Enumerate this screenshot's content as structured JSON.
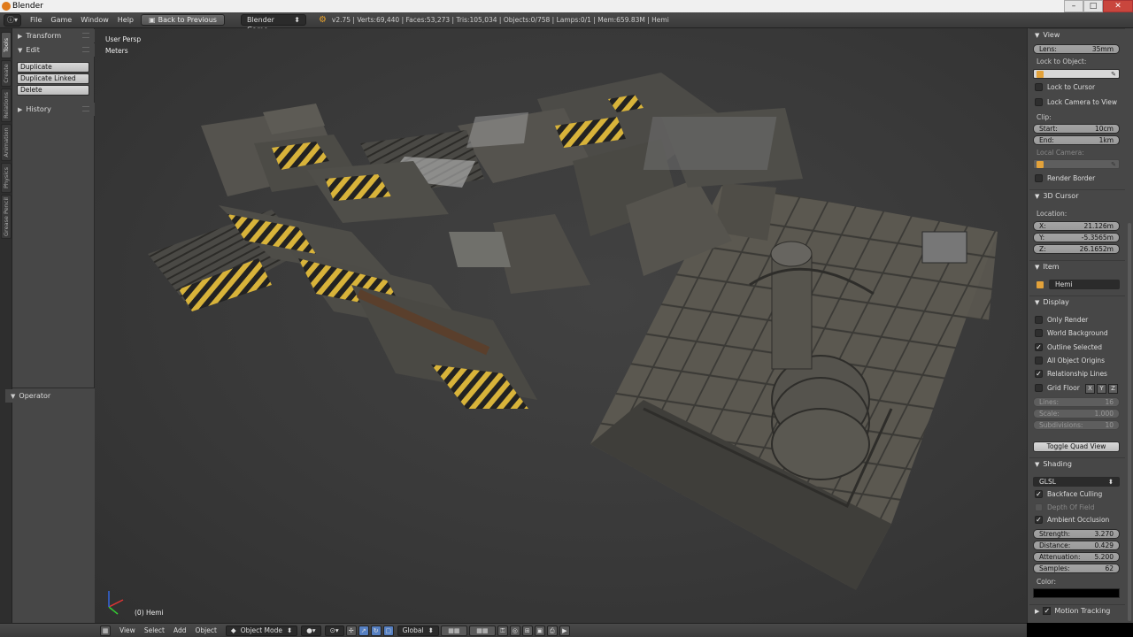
{
  "window": {
    "title": "Blender",
    "minimize": "–",
    "maximize": "□",
    "close": "✕"
  },
  "info_header": {
    "editor_icon": "i-icon",
    "menus": [
      "File",
      "Game",
      "Window",
      "Help"
    ],
    "back_button": "Back to Previous",
    "engine": "Blender Game",
    "stats": "v2.75 | Verts:69,440 | Faces:53,273 | Tris:105,034 | Objects:0/758 | Lamps:0/1 | Mem:659.83M | Hemi"
  },
  "tab_strip": [
    "Tools",
    "Create",
    "Relations",
    "Animation",
    "Physics",
    "Grease Pencil"
  ],
  "tool_shelf": {
    "transform_label": "Transform",
    "edit_label": "Edit",
    "buttons": [
      "Duplicate",
      "Duplicate Linked",
      "Delete"
    ],
    "history_label": "History",
    "operator_label": "Operator"
  },
  "viewport": {
    "view_name": "User Persp",
    "units": "Meters",
    "object_label": "(0) Hemi",
    "accent_yellow": "#d8b33a",
    "floor_color": "#5b5850"
  },
  "bottom_header": {
    "menus": [
      "View",
      "Select",
      "Add",
      "Object"
    ],
    "mode": "Object Mode",
    "orientation": "Global"
  },
  "properties": {
    "view": {
      "header": "View",
      "lens_label": "Lens:",
      "lens_value": "35mm",
      "lock_to_object": "Lock to Object:",
      "lock_to_cursor": "Lock to Cursor",
      "lock_camera": "Lock Camera to View",
      "clip_label": "Clip:",
      "start_label": "Start:",
      "start_value": "10cm",
      "end_label": "End:",
      "end_value": "1km",
      "local_camera": "Local Camera:",
      "render_border": "Render Border"
    },
    "cursor": {
      "header": "3D Cursor",
      "location_label": "Location:",
      "x_label": "X:",
      "x_value": "21.126m",
      "y_label": "Y:",
      "y_value": "-5.3565m",
      "z_label": "Z:",
      "z_value": "26.1652m"
    },
    "item": {
      "header": "Item",
      "name": "Hemi"
    },
    "display": {
      "header": "Display",
      "only_render": "Only Render",
      "world_background": "World Background",
      "outline_selected": "Outline Selected",
      "all_object_origins": "All Object Origins",
      "relationship_lines": "Relationship Lines",
      "grid_floor": "Grid Floor",
      "axis_x": "X",
      "axis_y": "Y",
      "axis_z": "Z",
      "lines_label": "Lines:",
      "lines_value": "16",
      "scale_label": "Scale:",
      "scale_value": "1.000",
      "subdivisions_label": "Subdivisions:",
      "subdivisions_value": "10",
      "toggle_quad_view": "Toggle Quad View"
    },
    "shading": {
      "header": "Shading",
      "mode": "GLSL",
      "backface_culling": "Backface Culling",
      "depth_of_field": "Depth Of Field",
      "ambient_occlusion": "Ambient Occlusion",
      "strength_label": "Strength:",
      "strength_value": "3.270",
      "distance_label": "Distance:",
      "distance_value": "0.429",
      "attenuation_label": "Attenuation:",
      "attenuation_value": "5.200",
      "samples_label": "Samples:",
      "samples_value": "62",
      "color_label": "Color:",
      "color_value": "#000000"
    },
    "motion_tracking": {
      "header": "Motion Tracking"
    }
  }
}
